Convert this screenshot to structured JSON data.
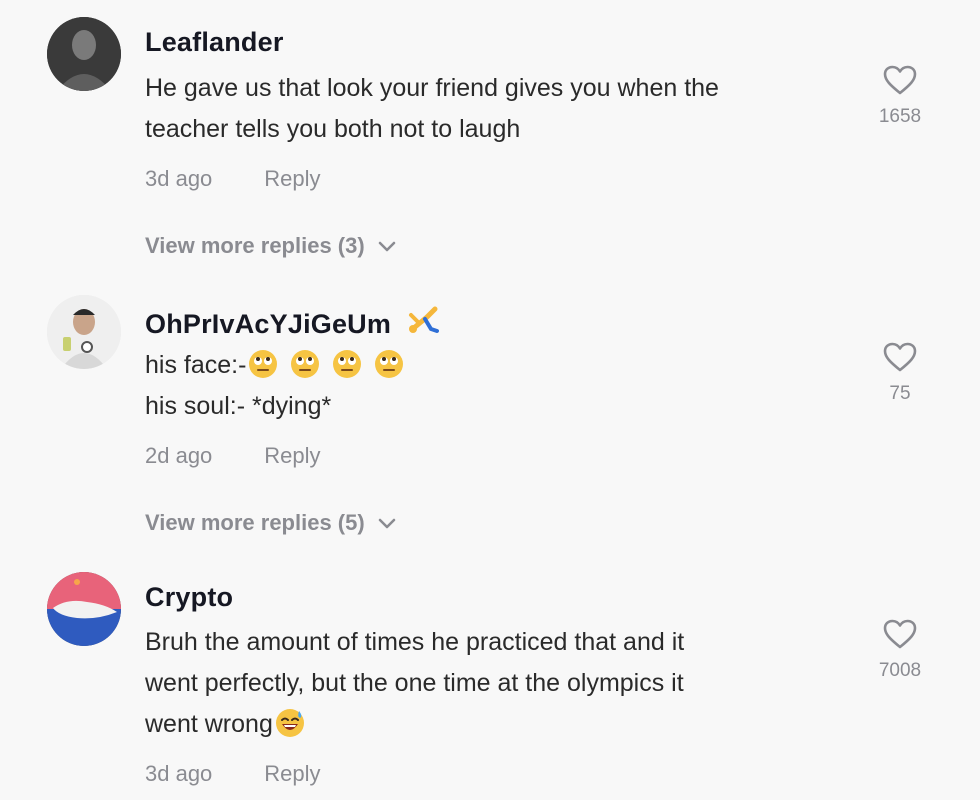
{
  "comments": [
    {
      "username": "Leaflander",
      "lines": [
        "He gave us that look your friend gives you when the",
        "teacher tells you both not to laugh"
      ],
      "time": "3d ago",
      "reply_label": "Reply",
      "likes": "1658",
      "more_replies": "View more replies (3)",
      "icon": "heart-outline-icon"
    },
    {
      "username": "OhPrIvAcYJiGeUm",
      "line1": "his face:-",
      "line2": "his soul:- *dying*",
      "time": "2d ago",
      "reply_label": "Reply",
      "likes": "75",
      "more_replies": "View more replies (5)",
      "emojis": [
        "rolling-eyes-emoji",
        "rolling-eyes-emoji",
        "rolling-eyes-emoji",
        "rolling-eyes-emoji"
      ],
      "username_emoji": "cartwheel-emoji"
    },
    {
      "username": "Crypto",
      "lines": [
        "Bruh the amount of times he practiced that and it",
        "went perfectly, but the one time at the olympics it"
      ],
      "line3": "went wrong",
      "time": "3d ago",
      "reply_label": "Reply",
      "likes": "7008",
      "end_emoji": "grinning-sweat-emoji"
    }
  ],
  "colors": {
    "background": "#f8f8f8",
    "muted": "#8a8b91",
    "text": "#161823"
  }
}
